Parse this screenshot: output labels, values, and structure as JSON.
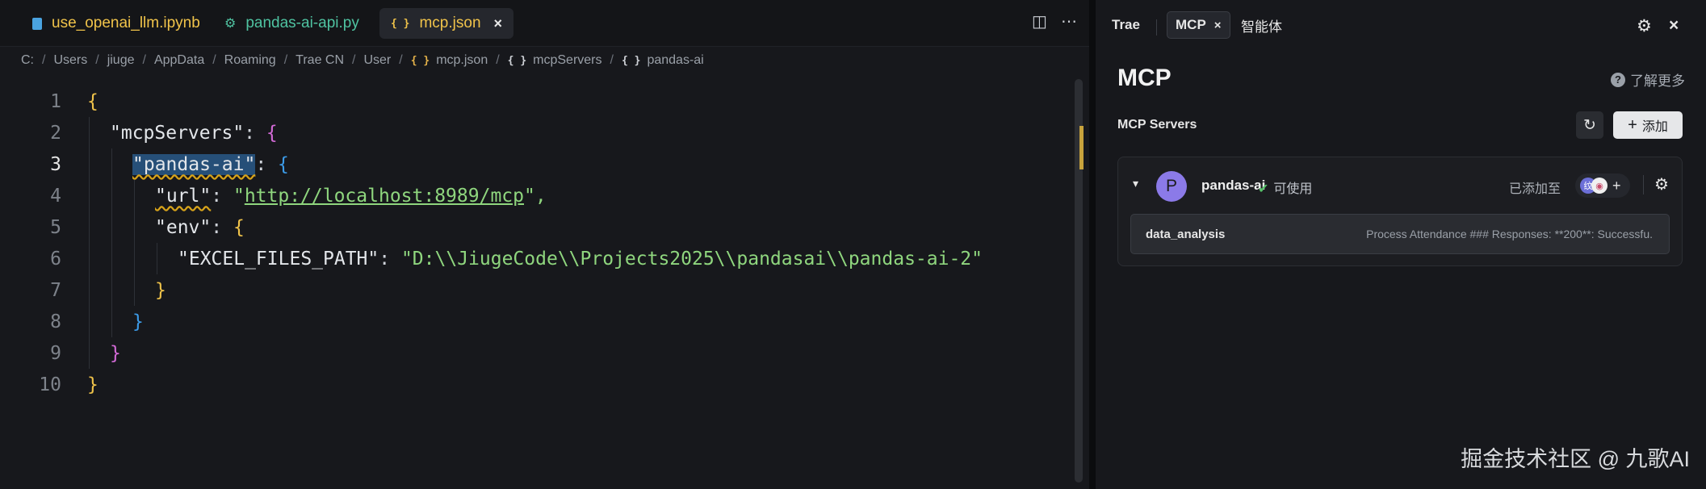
{
  "editor": {
    "tabs": [
      {
        "label": "use_openai_llm.ipynb",
        "color": "#f0c34a",
        "icon": "notebook-icon"
      },
      {
        "label": "pandas-ai-api.py",
        "color": "#4fc3a1",
        "icon": "python-icon"
      },
      {
        "label": "mcp.json",
        "color": "#f0c34a",
        "icon": "json-icon",
        "active": true
      }
    ],
    "tab_close": "×",
    "json_icon": "{ }",
    "breadcrumb": [
      "C:",
      "Users",
      "jiuge",
      "AppData",
      "Roaming",
      "Trae CN",
      "User",
      "mcp.json",
      "mcpServers",
      "pandas-ai"
    ],
    "breadcrumb_sep": "/",
    "current_line": 3,
    "lines": {
      "l1_open": "{",
      "l2_key": "\"mcpServers\"",
      "l2_colon": ": ",
      "l2_brace": "{",
      "l3_key": "\"pandas-ai\"",
      "l3_colon": ": ",
      "l3_brace": "{",
      "l4_key": "\"url\"",
      "l4_colon": ": ",
      "l4_q1": "\"",
      "l4_url": "http://localhost:8989/mcp",
      "l4_q2": "\",",
      "l5_key": "\"env\"",
      "l5_colon": ": ",
      "l5_brace": "{",
      "l6_key": "\"EXCEL_FILES_PATH\"",
      "l6_colon": ": ",
      "l6_value": "\"D:\\\\JiugeCode\\\\Projects2025\\\\pandasai\\\\pandas-ai-2\"",
      "l7_close": "}",
      "l8_close": "}",
      "l9_close": "}",
      "l10_close": "}"
    },
    "line_numbers": [
      "1",
      "2",
      "3",
      "4",
      "5",
      "6",
      "7",
      "8",
      "9",
      "10"
    ]
  },
  "panel": {
    "tabs": {
      "trae": "Trae",
      "mcp": "MCP",
      "agent": "智能体"
    },
    "close": "×",
    "title": "MCP",
    "learn_more": "了解更多",
    "help_glyph": "?",
    "servers_label": "MCP Servers",
    "add_label": "添加",
    "add_glyph": "+",
    "server": {
      "avatar_letter": "P",
      "name": "pandas-ai",
      "status": "可使用",
      "added_to": "已添加至",
      "agent1": "纹",
      "agent2": "◉",
      "tool_name": "data_analysis",
      "tool_desc": "Process Attendance ### Responses: **200**: Successfu."
    }
  },
  "watermark": "掘金技术社区 @ 九歌AI"
}
